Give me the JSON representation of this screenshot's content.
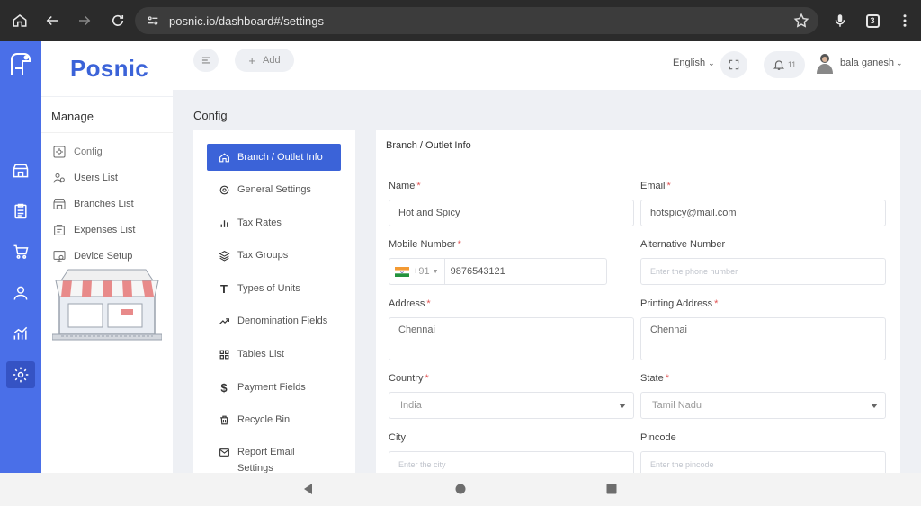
{
  "browser": {
    "url": "posnic.io/dashboard#/settings",
    "tab_count": "3"
  },
  "app": {
    "brand": "Posnic"
  },
  "sidebar": {
    "section_title": "Manage",
    "items": [
      {
        "label": "Config",
        "icon": "settings-icon"
      },
      {
        "label": "Users List",
        "icon": "users-icon"
      },
      {
        "label": "Branches List",
        "icon": "store-icon"
      },
      {
        "label": "Expenses List",
        "icon": "expenses-icon"
      },
      {
        "label": "Device Setup",
        "icon": "device-icon"
      }
    ]
  },
  "header": {
    "add_label": "Add",
    "language": "English",
    "notification_count": "11",
    "user_name": "bala ganesh"
  },
  "page": {
    "title": "Config"
  },
  "config_nav": {
    "items": [
      {
        "label": "Branch / Outlet Info",
        "icon": "home-icon"
      },
      {
        "label": "General Settings",
        "icon": "gear-icon"
      },
      {
        "label": "Tax Rates",
        "icon": "bar-chart-icon"
      },
      {
        "label": "Tax Groups",
        "icon": "layers-icon"
      },
      {
        "label": "Types of Units",
        "icon": "text-icon"
      },
      {
        "label": "Denomination Fields",
        "icon": "trend-icon"
      },
      {
        "label": "Tables List",
        "icon": "grid-icon"
      },
      {
        "label": "Payment Fields",
        "icon": "dollar-icon"
      },
      {
        "label": "Recycle Bin",
        "icon": "trash-icon"
      },
      {
        "label": "Report Email Settings",
        "icon": "mail-icon"
      }
    ]
  },
  "form": {
    "title": "Branch / Outlet Info",
    "name": {
      "label": "Name",
      "value": "Hot and Spicy"
    },
    "email": {
      "label": "Email",
      "value": "hotspicy@mail.com"
    },
    "mobile": {
      "label": "Mobile Number",
      "country_code": "+91",
      "value": "9876543121"
    },
    "alt_number": {
      "label": "Alternative Number",
      "placeholder": "Enter the phone number"
    },
    "address": {
      "label": "Address",
      "value": "Chennai"
    },
    "printing_address": {
      "label": "Printing Address",
      "value": "Chennai"
    },
    "country": {
      "label": "Country",
      "value": "India"
    },
    "state": {
      "label": "State",
      "value": "Tamil Nadu"
    },
    "city": {
      "label": "City",
      "placeholder": "Enter the city"
    },
    "pincode": {
      "label": "Pincode",
      "placeholder": "Enter the pincode"
    }
  },
  "colors": {
    "primary": "#3b63d8",
    "rail": "#4a6fe8",
    "required": "#e25555"
  }
}
